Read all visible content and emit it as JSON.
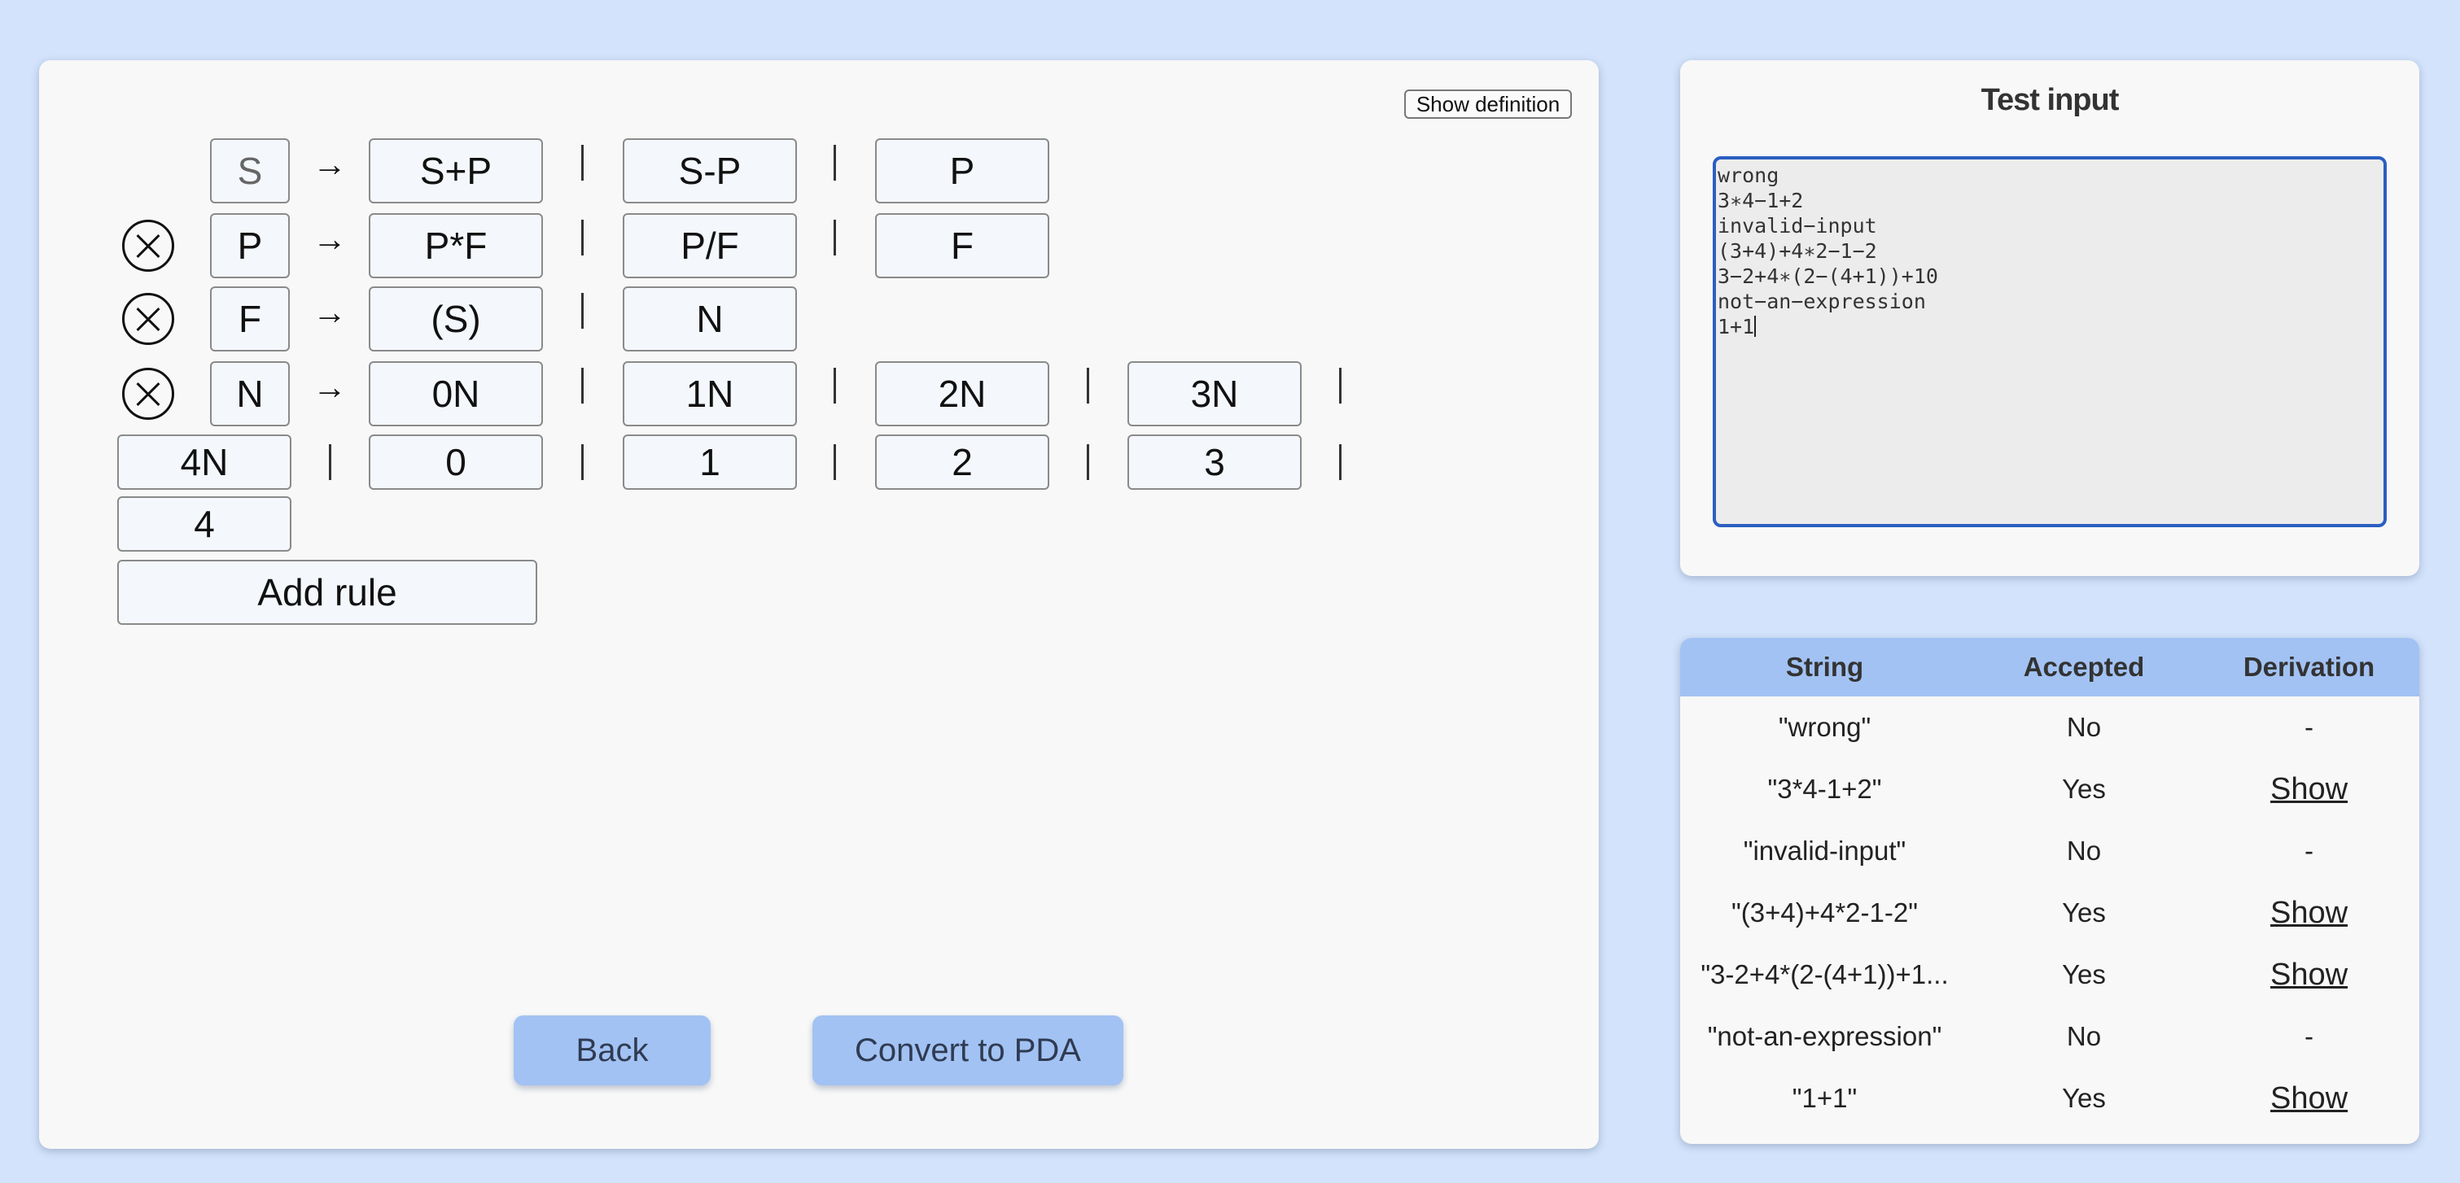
{
  "grammar": {
    "show_definition_label": "Show definition",
    "rules": [
      {
        "lhs": "S",
        "arrow": "→",
        "alternatives": [
          "S+P",
          "S-P",
          "P"
        ]
      },
      {
        "lhs": "P",
        "arrow": "→",
        "alternatives": [
          "P*F",
          "P/F",
          "F"
        ]
      },
      {
        "lhs": "F",
        "arrow": "→",
        "alternatives": [
          "(S)",
          "N"
        ]
      },
      {
        "lhs": "N",
        "arrow": "→",
        "alternatives": [
          "0N",
          "1N",
          "2N",
          "3N",
          "4N",
          "0",
          "1",
          "2",
          "3",
          "4"
        ]
      }
    ],
    "add_rule_label": "Add rule"
  },
  "buttons": {
    "back": "Back",
    "convert": "Convert to PDA"
  },
  "test": {
    "title": "Test input",
    "lines": [
      "wrong",
      "3∗4−1+2",
      "invalid−input",
      "(3+4)+4∗2−1−2",
      "3−2+4∗(2−(4+1))+10",
      "not−an−expression",
      "1+1"
    ]
  },
  "results": {
    "headers": [
      "String",
      "Accepted",
      "Derivation"
    ],
    "rows": [
      {
        "string": "\"wrong\"",
        "accepted": "No",
        "derivation": "-"
      },
      {
        "string": "\"3*4-1+2\"",
        "accepted": "Yes",
        "derivation": "Show"
      },
      {
        "string": "\"invalid-input\"",
        "accepted": "No",
        "derivation": "-"
      },
      {
        "string": "\"(3+4)+4*2-1-2\"",
        "accepted": "Yes",
        "derivation": "Show"
      },
      {
        "string": "\"3-2+4*(2-(4+1))+1...",
        "accepted": "Yes",
        "derivation": "Show"
      },
      {
        "string": "\"not-an-expression\"",
        "accepted": "No",
        "derivation": "-"
      },
      {
        "string": "\"1+1\"",
        "accepted": "Yes",
        "derivation": "Show"
      }
    ]
  }
}
